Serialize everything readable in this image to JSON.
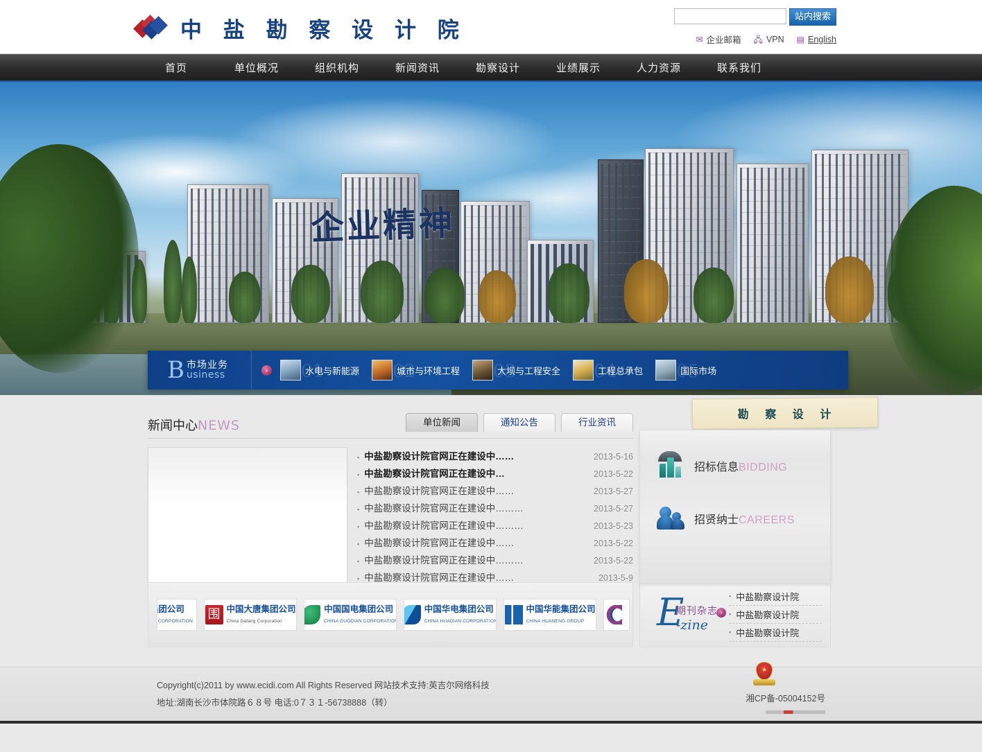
{
  "site": {
    "logo_text": "中 盐 勘 察 设 计 院",
    "logo_icon": "diamond-logo-icon",
    "brand_blue": "#16437f",
    "brand_red": "#b5202b"
  },
  "header": {
    "search": {
      "value": "",
      "placeholder": "",
      "button_label": "站内搜索",
      "icon": "search-icon"
    },
    "utils": [
      {
        "label": "企业邮箱",
        "icon": "mail-icon"
      },
      {
        "label": "VPN",
        "icon": "vpn-icon"
      },
      {
        "label": "English",
        "icon": "document-icon"
      }
    ]
  },
  "nav": {
    "items": [
      {
        "label": "首页"
      },
      {
        "label": "单位概况"
      },
      {
        "label": "组织机构"
      },
      {
        "label": "新闻资讯"
      },
      {
        "label": "勘察设计"
      },
      {
        "label": "业绩展示"
      },
      {
        "label": "人力资源"
      },
      {
        "label": "联系我们"
      }
    ]
  },
  "banner": {
    "slogan": "企业精神",
    "business": {
      "cn": "市场业务",
      "initial": "B",
      "en": "usiness",
      "arrow": "›",
      "items": [
        {
          "num": "01",
          "label": "水电与新能源",
          "thumb": "hydropower-thumb"
        },
        {
          "num": "02",
          "label": "城市与环境工程",
          "thumb": "urban-environment-thumb"
        },
        {
          "num": "03",
          "label": "大坝与工程安全",
          "thumb": "dam-safety-thumb"
        },
        {
          "num": "04",
          "label": "工程总承包",
          "thumb": "epc-thumb"
        },
        {
          "num": "05",
          "label": "国际市场",
          "thumb": "international-thumb"
        }
      ]
    }
  },
  "news": {
    "title_cn": "新闻中心",
    "title_en": "NEWS",
    "tabs": [
      {
        "label": "单位新闻",
        "active": true
      },
      {
        "label": "通知公告",
        "active": false
      },
      {
        "label": "行业资讯",
        "active": false
      }
    ],
    "photo_alt": "news-feature-image",
    "items": [
      {
        "title": "中盐勘察设计院官网正在建设中……",
        "date": "2013-5-16",
        "bold": true
      },
      {
        "title": "中盐勘察设计院官网正在建设中…",
        "date": "2013-5-22",
        "bold": true
      },
      {
        "title": "中盐勘察设计院官网正在建设中……",
        "date": "2013-5-27",
        "bold": false
      },
      {
        "title": "中盐勘察设计院官网正在建设中………",
        "date": "2013-5-27",
        "bold": false
      },
      {
        "title": "中盐勘察设计院官网正在建设中………",
        "date": "2013-5-23",
        "bold": false
      },
      {
        "title": "中盐勘察设计院官网正在建设中……",
        "date": "2013-5-22",
        "bold": false
      },
      {
        "title": "中盐勘察设计院官网正在建设中………",
        "date": "2013-5-22",
        "bold": false
      },
      {
        "title": "中盐勘察设计院官网正在建设中……",
        "date": "2013-5-9",
        "bold": false
      }
    ]
  },
  "sidebar": {
    "tab_label": "勘 察 设 计",
    "items": [
      {
        "cn": "招标信息",
        "en": "BIDDING",
        "icon": "bidding-chart-icon"
      },
      {
        "cn": "招贤纳士",
        "en": "CAREERS",
        "icon": "people-icon"
      }
    ]
  },
  "partners": [
    {
      "cn": "资集团公司",
      "en": "TRUST CORPORATION",
      "mark": "trust-mark",
      "cut": "left"
    },
    {
      "cn": "中国大唐集团公司",
      "en": "China Datang Corporation",
      "mark": "datang-mark",
      "cut": ""
    },
    {
      "cn": "中国国电集团公司",
      "en": "CHINA GUODIAN CORPORATION",
      "mark": "guodian-mark",
      "cut": ""
    },
    {
      "cn": "中国华电集团公司",
      "en": "CHINA HUADIAN CORPORATION",
      "mark": "huadian-mark",
      "cut": ""
    },
    {
      "cn": "中国华能集团公司",
      "en": "CHINA HUANENG GROUP",
      "mark": "huaneng-mark",
      "cut": ""
    },
    {
      "cn": "",
      "en": "",
      "mark": "crescent-mark",
      "cut": "right"
    }
  ],
  "ezine": {
    "initial": "E",
    "cn": "期刊杂志",
    "script": "-zine",
    "arrow": "›",
    "items": [
      {
        "label": "中盐勘察设计院"
      },
      {
        "label": "中盐勘察设计院"
      },
      {
        "label": "中盐勘察设计院"
      }
    ]
  },
  "footer": {
    "line1": "Copyright(c)2011 by www.ecidi.com All Rights Reserved 网站技术支持:英吉尔网络科技",
    "line2": "地址:湖南长沙市体院路６８号  电话:0７３１-56738888（转）",
    "icp": "湘CP备-05004152号",
    "badge_icon": "police-badge-icon"
  }
}
